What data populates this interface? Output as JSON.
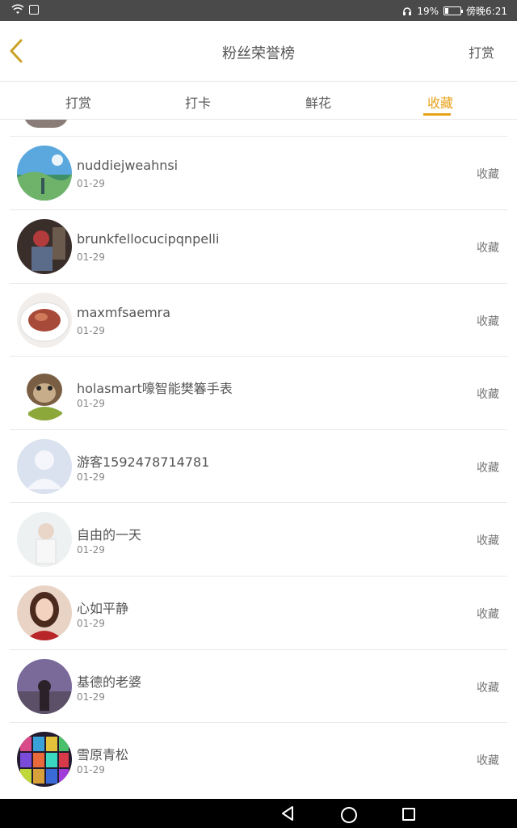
{
  "status": {
    "battery": "19%",
    "time": "傍晚6:21"
  },
  "header": {
    "title": "粉丝荣誉榜",
    "right_label": "打赏"
  },
  "tabs": [
    {
      "label": "打赏",
      "active": false
    },
    {
      "label": "打卡",
      "active": false
    },
    {
      "label": "鲜花",
      "active": false
    },
    {
      "label": "收藏",
      "active": true
    }
  ],
  "colors": {
    "accent": "#e8a21a",
    "status_bar": "#4a4a4a",
    "nav_bar": "#000000"
  },
  "rows": [
    {
      "name": "nuddiejweahnsi",
      "date": "01-29",
      "action": "收藏",
      "avatar": "landscape"
    },
    {
      "name": "brunkfellocucipqnpelli",
      "date": "01-29",
      "action": "收藏",
      "avatar": "person-dark"
    },
    {
      "name": "maxmfsaemra",
      "date": "01-29",
      "action": "收藏",
      "avatar": "food-plate"
    },
    {
      "name": "holasmart嚎智能樊箺手表",
      "date": "01-29",
      "action": "收藏",
      "avatar": "sloth-cartoon"
    },
    {
      "name": "游客1592478714781",
      "date": "01-29",
      "action": "收藏",
      "avatar": "default-user"
    },
    {
      "name": "自由的一天",
      "date": "01-29",
      "action": "收藏",
      "avatar": "girl-light"
    },
    {
      "name": "心如平静",
      "date": "01-29",
      "action": "收藏",
      "avatar": "woman-portrait"
    },
    {
      "name": "基德的老婆",
      "date": "01-29",
      "action": "收藏",
      "avatar": "girl-purple"
    },
    {
      "name": "雪原青松",
      "date": "01-29",
      "action": "收藏",
      "avatar": "cards-colorful"
    }
  ]
}
